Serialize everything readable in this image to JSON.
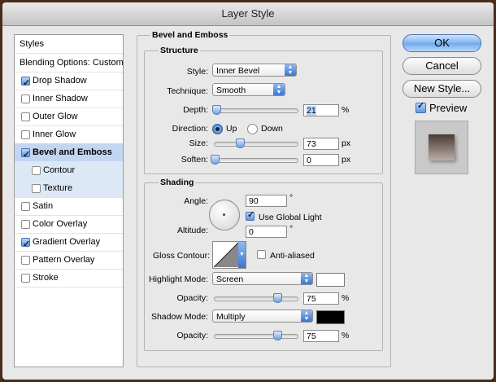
{
  "window": {
    "title": "Layer Style"
  },
  "styles_list": {
    "header": "Styles",
    "blending": "Blending Options: Custom",
    "items": [
      {
        "label": "Drop Shadow",
        "checked": true,
        "selected": false,
        "sub": false
      },
      {
        "label": "Inner Shadow",
        "checked": false,
        "selected": false,
        "sub": false
      },
      {
        "label": "Outer Glow",
        "checked": false,
        "selected": false,
        "sub": false
      },
      {
        "label": "Inner Glow",
        "checked": false,
        "selected": false,
        "sub": false
      },
      {
        "label": "Bevel and Emboss",
        "checked": true,
        "selected": true,
        "sub": false
      },
      {
        "label": "Contour",
        "checked": false,
        "selected": false,
        "sub": true
      },
      {
        "label": "Texture",
        "checked": false,
        "selected": false,
        "sub": true
      },
      {
        "label": "Satin",
        "checked": false,
        "selected": false,
        "sub": false
      },
      {
        "label": "Color Overlay",
        "checked": false,
        "selected": false,
        "sub": false
      },
      {
        "label": "Gradient Overlay",
        "checked": true,
        "selected": false,
        "sub": false
      },
      {
        "label": "Pattern Overlay",
        "checked": false,
        "selected": false,
        "sub": false
      },
      {
        "label": "Stroke",
        "checked": false,
        "selected": false,
        "sub": false
      }
    ]
  },
  "bevel": {
    "title": "Bevel and Emboss",
    "structure": {
      "title": "Structure",
      "style_label": "Style:",
      "style_value": "Inner Bevel",
      "technique_label": "Technique:",
      "technique_value": "Smooth",
      "depth_label": "Depth:",
      "depth_value": "21",
      "depth_unit": "%",
      "depth_slider": 0.02,
      "direction_label": "Direction:",
      "direction_up": "Up",
      "direction_down": "Down",
      "direction_selected": "Up",
      "size_label": "Size:",
      "size_value": "73",
      "size_unit": "px",
      "size_slider": 0.3,
      "soften_label": "Soften:",
      "soften_value": "0",
      "soften_unit": "px",
      "soften_slider": 0.0
    },
    "shading": {
      "title": "Shading",
      "angle_label": "Angle:",
      "angle_value": "90",
      "angle_unit": "°",
      "global_light_label": "Use Global Light",
      "global_light_checked": true,
      "altitude_label": "Altitude:",
      "altitude_value": "0",
      "altitude_unit": "°",
      "gloss_label": "Gloss Contour:",
      "anti_aliased_label": "Anti-aliased",
      "anti_aliased_checked": false,
      "highlight_label": "Highlight Mode:",
      "highlight_value": "Screen",
      "highlight_color": "#ffffff",
      "highlight_opacity_label": "Opacity:",
      "highlight_opacity": "75",
      "highlight_opacity_unit": "%",
      "highlight_opacity_slider": 0.75,
      "shadow_label": "Shadow Mode:",
      "shadow_value": "Multiply",
      "shadow_color": "#000000",
      "shadow_opacity_label": "Opacity:",
      "shadow_opacity": "75",
      "shadow_opacity_unit": "%",
      "shadow_opacity_slider": 0.75
    }
  },
  "buttons": {
    "ok": "OK",
    "cancel": "Cancel",
    "new_style": "New Style...",
    "preview": "Preview",
    "preview_checked": true
  }
}
